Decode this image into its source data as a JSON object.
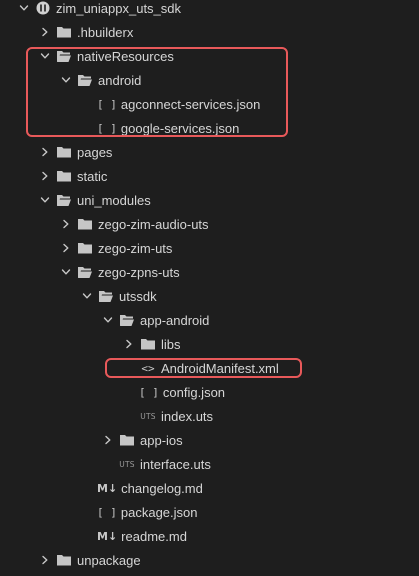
{
  "explorer": {
    "items": [
      {
        "label": "zim_uniappx_uts_sdk",
        "icon": "root-icon",
        "chevron": "down",
        "depth": 0
      },
      {
        "label": ".hbuilderx",
        "icon": "folder-icon",
        "chevron": "right",
        "depth": 1
      },
      {
        "label": "nativeResources",
        "icon": "folder-open-icon",
        "chevron": "down",
        "depth": 1
      },
      {
        "label": "android",
        "icon": "folder-open-icon",
        "chevron": "down",
        "depth": 2
      },
      {
        "label": "agconnect-services.json",
        "icon": "json-icon",
        "chevron": "none",
        "depth": 3
      },
      {
        "label": "google-services.json",
        "icon": "json-icon",
        "chevron": "none",
        "depth": 3
      },
      {
        "label": "pages",
        "icon": "folder-icon",
        "chevron": "right",
        "depth": 1
      },
      {
        "label": "static",
        "icon": "folder-icon",
        "chevron": "right",
        "depth": 1
      },
      {
        "label": "uni_modules",
        "icon": "folder-open-icon",
        "chevron": "down",
        "depth": 1
      },
      {
        "label": "zego-zim-audio-uts",
        "icon": "folder-icon",
        "chevron": "right",
        "depth": 2
      },
      {
        "label": "zego-zim-uts",
        "icon": "folder-icon",
        "chevron": "right",
        "depth": 2
      },
      {
        "label": "zego-zpns-uts",
        "icon": "folder-open-icon",
        "chevron": "down",
        "depth": 2
      },
      {
        "label": "utssdk",
        "icon": "folder-open-icon",
        "chevron": "down",
        "depth": 3
      },
      {
        "label": "app-android",
        "icon": "folder-open-icon",
        "chevron": "down",
        "depth": 4
      },
      {
        "label": "libs",
        "icon": "folder-icon",
        "chevron": "right",
        "depth": 5
      },
      {
        "label": "AndroidManifest.xml",
        "icon": "xml-icon",
        "chevron": "none",
        "depth": 5
      },
      {
        "label": "config.json",
        "icon": "json-icon",
        "chevron": "none",
        "depth": 5
      },
      {
        "label": "index.uts",
        "icon": "uts-icon",
        "chevron": "none",
        "depth": 5
      },
      {
        "label": "app-ios",
        "icon": "folder-icon",
        "chevron": "right",
        "depth": 4
      },
      {
        "label": "interface.uts",
        "icon": "uts-icon",
        "chevron": "none",
        "depth": 4
      },
      {
        "label": "changelog.md",
        "icon": "markdown-icon",
        "chevron": "none",
        "depth": 3
      },
      {
        "label": "package.json",
        "icon": "json-icon",
        "chevron": "none",
        "depth": 3
      },
      {
        "label": "readme.md",
        "icon": "markdown-icon",
        "chevron": "none",
        "depth": 3
      },
      {
        "label": "unpackage",
        "icon": "folder-icon",
        "chevron": "right",
        "depth": 1
      }
    ],
    "icon_glyphs": {
      "json-icon": "[ ]",
      "xml-icon": "<>",
      "uts-icon": "UTS",
      "markdown-icon": "M↓"
    }
  },
  "highlights": [
    {
      "name": "highlight-native-resources",
      "from": 2,
      "to": 5
    },
    {
      "name": "highlight-android-manifest",
      "from": 15,
      "to": 15
    }
  ],
  "colors": {
    "background": "#1e1e1e",
    "text": "#d6d6d6",
    "highlight": "#e8595a",
    "icon": "#c5c5c5"
  }
}
